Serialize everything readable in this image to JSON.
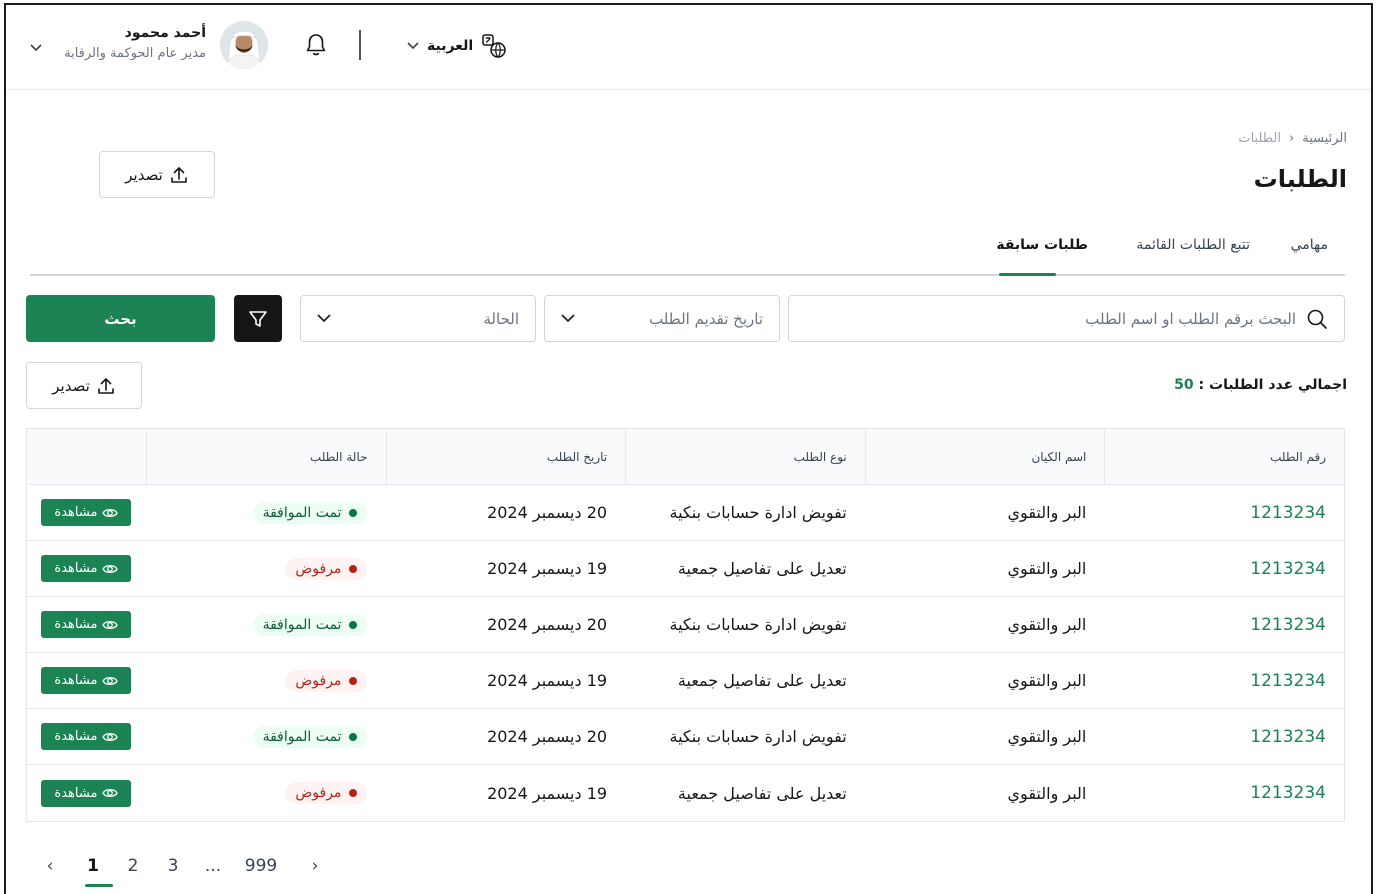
{
  "header": {
    "user_name": "أحمد محمود",
    "user_role": "مدير عام الحوكمة والرقابة",
    "language": "العربية"
  },
  "breadcrumb": {
    "home": "الرئيسية",
    "separator": "‹",
    "current": "الطلبات"
  },
  "page_title": "الطلبات",
  "export_label": "تصدير",
  "tabs": [
    {
      "label": "مهامي",
      "active": false
    },
    {
      "label": "تتبع الطلبات القائمة",
      "active": false
    },
    {
      "label": "طلبات سابقة",
      "active": true
    }
  ],
  "filters": {
    "search_placeholder": "البحث برقم الطلب او اسم الطلب",
    "date_placeholder": "تاريخ تقديم الطلب",
    "status_placeholder": "الحالة",
    "search_button": "بحث"
  },
  "total": {
    "label": "اجمالي عدد الطلبات :",
    "value": "50"
  },
  "table": {
    "columns": [
      "رقم الطلب",
      "اسم الكيان",
      "نوع الطلب",
      "تاريخ الطلب",
      "حالة الطلب",
      ""
    ],
    "rows": [
      {
        "req_no": "1213234",
        "entity": "البر والتقوي",
        "type": "تفويض ادارة حسابات بنكية",
        "date": "20 ديسمبر 2024",
        "status": "تمت الموافقة",
        "status_kind": "approved",
        "action": "مشاهدة"
      },
      {
        "req_no": "1213234",
        "entity": "البر والتقوي",
        "type": "تعديل على تفاصيل جمعية",
        "date": "19 ديسمبر 2024",
        "status": "مرفوض",
        "status_kind": "rejected",
        "action": "مشاهدة"
      },
      {
        "req_no": "1213234",
        "entity": "البر والتقوي",
        "type": "تفويض ادارة حسابات بنكية",
        "date": "20 ديسمبر 2024",
        "status": "تمت الموافقة",
        "status_kind": "approved",
        "action": "مشاهدة"
      },
      {
        "req_no": "1213234",
        "entity": "البر والتقوي",
        "type": "تعديل على تفاصيل جمعية",
        "date": "19 ديسمبر 2024",
        "status": "مرفوض",
        "status_kind": "rejected",
        "action": "مشاهدة"
      },
      {
        "req_no": "1213234",
        "entity": "البر والتقوي",
        "type": "تفويض ادارة حسابات بنكية",
        "date": "20 ديسمبر 2024",
        "status": "تمت الموافقة",
        "status_kind": "approved",
        "action": "مشاهدة"
      },
      {
        "req_no": "1213234",
        "entity": "البر والتقوي",
        "type": "تعديل على تفاصيل جمعية",
        "date": "19 ديسمبر 2024",
        "status": "مرفوض",
        "status_kind": "rejected",
        "action": "مشاهدة"
      }
    ]
  },
  "pagination": {
    "prev": "‹",
    "pages": [
      "1",
      "2",
      "3",
      "...",
      "999"
    ],
    "next": "›",
    "current": "1"
  },
  "colors": {
    "primary": "#1b8354",
    "dark": "#161616"
  }
}
